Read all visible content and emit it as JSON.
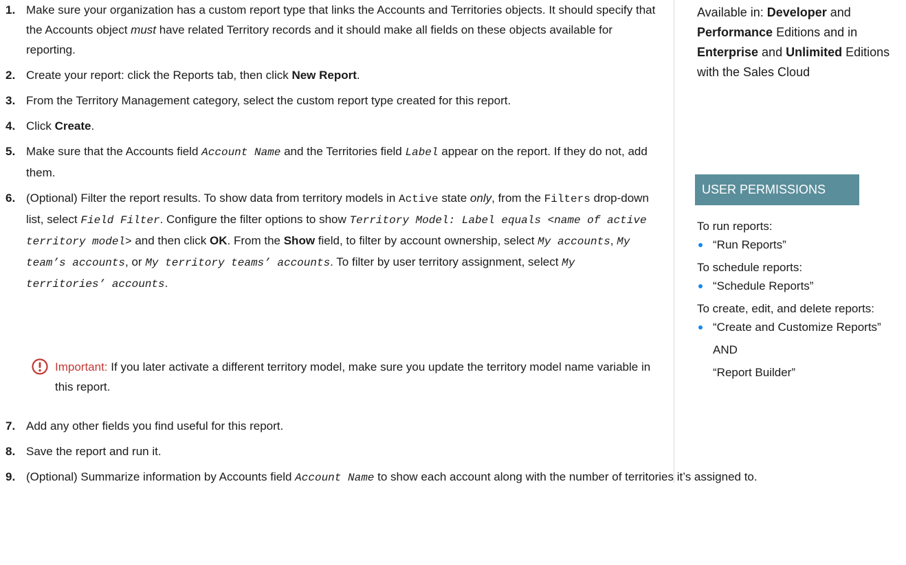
{
  "steps": [
    {
      "num": "1.",
      "segments": [
        {
          "t": "Make sure your organization has a custom report type that links the Accounts and Territories objects. It should specify that the Accounts object "
        },
        {
          "t": "must",
          "s": "em"
        },
        {
          "t": " have related Territory records and it should make all fields on these objects available for reporting."
        }
      ]
    },
    {
      "num": "2.",
      "segments": [
        {
          "t": "Create your report: click the Reports tab, then click "
        },
        {
          "t": "New Report",
          "s": "b"
        },
        {
          "t": "."
        }
      ]
    },
    {
      "num": "3.",
      "segments": [
        {
          "t": "From the Territory Management category, select the custom report type created for this report."
        }
      ]
    },
    {
      "num": "4.",
      "segments": [
        {
          "t": "Click "
        },
        {
          "t": "Create",
          "s": "b"
        },
        {
          "t": "."
        }
      ]
    },
    {
      "num": "5.",
      "segments": [
        {
          "t": "Make sure that the Accounts field "
        },
        {
          "t": "Account Name",
          "s": "mono-i"
        },
        {
          "t": " and the Territories field "
        },
        {
          "t": "Label",
          "s": "mono-i"
        },
        {
          "t": " appear on the report. If they do not, add them."
        }
      ]
    },
    {
      "num": "6.",
      "segments": [
        {
          "t": "(Optional) Filter the report results. To show data from territory models in "
        },
        {
          "t": "Active",
          "s": "mono"
        },
        {
          "t": " state "
        },
        {
          "t": "only",
          "s": "em"
        },
        {
          "t": ", from the "
        },
        {
          "t": "Filters",
          "s": "mono"
        },
        {
          "t": " drop-down list, select "
        },
        {
          "t": "Field Filter",
          "s": "mono-i"
        },
        {
          "t": ". Configure the filter options to show "
        },
        {
          "t": "Territory Model: Label equals <name of active territory model>",
          "s": "mono-i"
        },
        {
          "t": " and then click "
        },
        {
          "t": "OK",
          "s": "b"
        },
        {
          "t": ". From the "
        },
        {
          "t": "Show",
          "s": "b"
        },
        {
          "t": " field, to filter by account ownership, select "
        },
        {
          "t": "My accounts",
          "s": "mono-i"
        },
        {
          "t": ", "
        },
        {
          "t": "My team’s accounts",
          "s": "mono-i"
        },
        {
          "t": ", or "
        },
        {
          "t": "My territory teams’ accounts",
          "s": "mono-i"
        },
        {
          "t": ". To filter by user territory assignment, select "
        },
        {
          "t": "My territories’ accounts",
          "s": "mono-i"
        },
        {
          "t": "."
        }
      ]
    }
  ],
  "important": {
    "lead": "Important:",
    "body": " If you later activate a different territory model, make sure you update the territory model name variable in this report.",
    "icon": "important-icon",
    "color": "#c23934"
  },
  "later_steps": [
    {
      "num": "7.",
      "segments": [
        {
          "t": "Add any other fields you find useful for this report."
        }
      ]
    },
    {
      "num": "8.",
      "segments": [
        {
          "t": "Save the report and run it."
        }
      ]
    },
    {
      "num": "9.",
      "segments": [
        {
          "t": "(Optional) Summarize information by Accounts field "
        },
        {
          "t": "Account Name",
          "s": "mono-i"
        },
        {
          "t": " to show each account along with the number of territories it’s assigned to."
        }
      ]
    }
  ],
  "sidebar": {
    "editions": [
      {
        "t": "Available in: "
      },
      {
        "t": "Developer",
        "s": "b"
      },
      {
        "t": " and "
      },
      {
        "t": "Performance",
        "s": "b"
      },
      {
        "t": " Editions and in "
      },
      {
        "t": "Enterprise",
        "s": "b"
      },
      {
        "t": " and "
      },
      {
        "t": "Unlimited",
        "s": "b"
      },
      {
        "t": " Editions with the Sales Cloud"
      }
    ],
    "permissions_header": "USER PERMISSIONS",
    "header_color": "#5b8e9b",
    "groups": [
      {
        "title": "To run reports:",
        "items": [
          "“Run Reports”"
        ]
      },
      {
        "title": "To schedule reports:",
        "items": [
          "“Schedule Reports”"
        ]
      },
      {
        "title": "To create, edit, and delete reports:",
        "items": [
          "“Create and Customize Reports”"
        ],
        "extra": [
          "AND",
          "“Report Builder”"
        ]
      }
    ]
  }
}
